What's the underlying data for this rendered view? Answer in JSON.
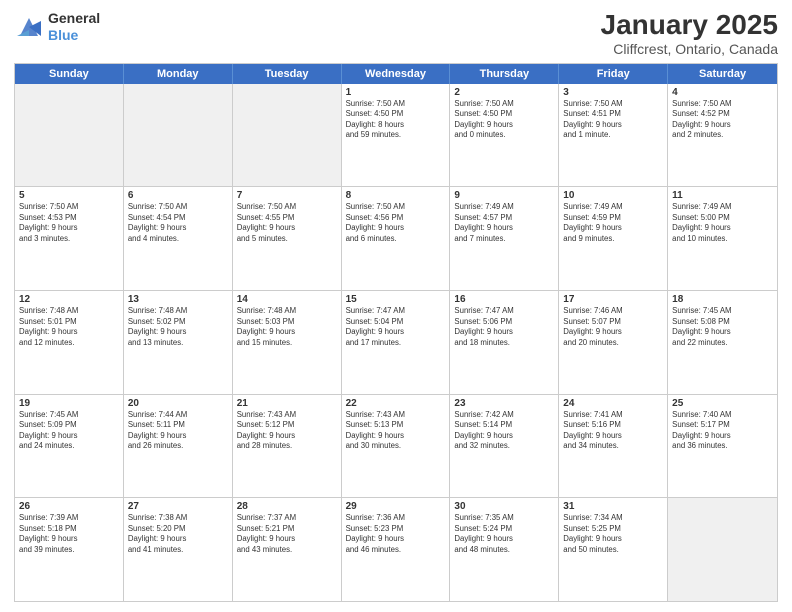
{
  "header": {
    "logo_line1": "General",
    "logo_line2": "Blue",
    "title": "January 2025",
    "subtitle": "Cliffcrest, Ontario, Canada"
  },
  "days_of_week": [
    "Sunday",
    "Monday",
    "Tuesday",
    "Wednesday",
    "Thursday",
    "Friday",
    "Saturday"
  ],
  "weeks": [
    [
      {
        "day": "",
        "info": "",
        "shaded": true
      },
      {
        "day": "",
        "info": "",
        "shaded": true
      },
      {
        "day": "",
        "info": "",
        "shaded": true
      },
      {
        "day": "1",
        "info": "Sunrise: 7:50 AM\nSunset: 4:50 PM\nDaylight: 8 hours\nand 59 minutes.",
        "shaded": false
      },
      {
        "day": "2",
        "info": "Sunrise: 7:50 AM\nSunset: 4:50 PM\nDaylight: 9 hours\nand 0 minutes.",
        "shaded": false
      },
      {
        "day": "3",
        "info": "Sunrise: 7:50 AM\nSunset: 4:51 PM\nDaylight: 9 hours\nand 1 minute.",
        "shaded": false
      },
      {
        "day": "4",
        "info": "Sunrise: 7:50 AM\nSunset: 4:52 PM\nDaylight: 9 hours\nand 2 minutes.",
        "shaded": false
      }
    ],
    [
      {
        "day": "5",
        "info": "Sunrise: 7:50 AM\nSunset: 4:53 PM\nDaylight: 9 hours\nand 3 minutes.",
        "shaded": false
      },
      {
        "day": "6",
        "info": "Sunrise: 7:50 AM\nSunset: 4:54 PM\nDaylight: 9 hours\nand 4 minutes.",
        "shaded": false
      },
      {
        "day": "7",
        "info": "Sunrise: 7:50 AM\nSunset: 4:55 PM\nDaylight: 9 hours\nand 5 minutes.",
        "shaded": false
      },
      {
        "day": "8",
        "info": "Sunrise: 7:50 AM\nSunset: 4:56 PM\nDaylight: 9 hours\nand 6 minutes.",
        "shaded": false
      },
      {
        "day": "9",
        "info": "Sunrise: 7:49 AM\nSunset: 4:57 PM\nDaylight: 9 hours\nand 7 minutes.",
        "shaded": false
      },
      {
        "day": "10",
        "info": "Sunrise: 7:49 AM\nSunset: 4:59 PM\nDaylight: 9 hours\nand 9 minutes.",
        "shaded": false
      },
      {
        "day": "11",
        "info": "Sunrise: 7:49 AM\nSunset: 5:00 PM\nDaylight: 9 hours\nand 10 minutes.",
        "shaded": false
      }
    ],
    [
      {
        "day": "12",
        "info": "Sunrise: 7:48 AM\nSunset: 5:01 PM\nDaylight: 9 hours\nand 12 minutes.",
        "shaded": false
      },
      {
        "day": "13",
        "info": "Sunrise: 7:48 AM\nSunset: 5:02 PM\nDaylight: 9 hours\nand 13 minutes.",
        "shaded": false
      },
      {
        "day": "14",
        "info": "Sunrise: 7:48 AM\nSunset: 5:03 PM\nDaylight: 9 hours\nand 15 minutes.",
        "shaded": false
      },
      {
        "day": "15",
        "info": "Sunrise: 7:47 AM\nSunset: 5:04 PM\nDaylight: 9 hours\nand 17 minutes.",
        "shaded": false
      },
      {
        "day": "16",
        "info": "Sunrise: 7:47 AM\nSunset: 5:06 PM\nDaylight: 9 hours\nand 18 minutes.",
        "shaded": false
      },
      {
        "day": "17",
        "info": "Sunrise: 7:46 AM\nSunset: 5:07 PM\nDaylight: 9 hours\nand 20 minutes.",
        "shaded": false
      },
      {
        "day": "18",
        "info": "Sunrise: 7:45 AM\nSunset: 5:08 PM\nDaylight: 9 hours\nand 22 minutes.",
        "shaded": false
      }
    ],
    [
      {
        "day": "19",
        "info": "Sunrise: 7:45 AM\nSunset: 5:09 PM\nDaylight: 9 hours\nand 24 minutes.",
        "shaded": false
      },
      {
        "day": "20",
        "info": "Sunrise: 7:44 AM\nSunset: 5:11 PM\nDaylight: 9 hours\nand 26 minutes.",
        "shaded": false
      },
      {
        "day": "21",
        "info": "Sunrise: 7:43 AM\nSunset: 5:12 PM\nDaylight: 9 hours\nand 28 minutes.",
        "shaded": false
      },
      {
        "day": "22",
        "info": "Sunrise: 7:43 AM\nSunset: 5:13 PM\nDaylight: 9 hours\nand 30 minutes.",
        "shaded": false
      },
      {
        "day": "23",
        "info": "Sunrise: 7:42 AM\nSunset: 5:14 PM\nDaylight: 9 hours\nand 32 minutes.",
        "shaded": false
      },
      {
        "day": "24",
        "info": "Sunrise: 7:41 AM\nSunset: 5:16 PM\nDaylight: 9 hours\nand 34 minutes.",
        "shaded": false
      },
      {
        "day": "25",
        "info": "Sunrise: 7:40 AM\nSunset: 5:17 PM\nDaylight: 9 hours\nand 36 minutes.",
        "shaded": false
      }
    ],
    [
      {
        "day": "26",
        "info": "Sunrise: 7:39 AM\nSunset: 5:18 PM\nDaylight: 9 hours\nand 39 minutes.",
        "shaded": false
      },
      {
        "day": "27",
        "info": "Sunrise: 7:38 AM\nSunset: 5:20 PM\nDaylight: 9 hours\nand 41 minutes.",
        "shaded": false
      },
      {
        "day": "28",
        "info": "Sunrise: 7:37 AM\nSunset: 5:21 PM\nDaylight: 9 hours\nand 43 minutes.",
        "shaded": false
      },
      {
        "day": "29",
        "info": "Sunrise: 7:36 AM\nSunset: 5:23 PM\nDaylight: 9 hours\nand 46 minutes.",
        "shaded": false
      },
      {
        "day": "30",
        "info": "Sunrise: 7:35 AM\nSunset: 5:24 PM\nDaylight: 9 hours\nand 48 minutes.",
        "shaded": false
      },
      {
        "day": "31",
        "info": "Sunrise: 7:34 AM\nSunset: 5:25 PM\nDaylight: 9 hours\nand 50 minutes.",
        "shaded": false
      },
      {
        "day": "",
        "info": "",
        "shaded": true
      }
    ]
  ]
}
